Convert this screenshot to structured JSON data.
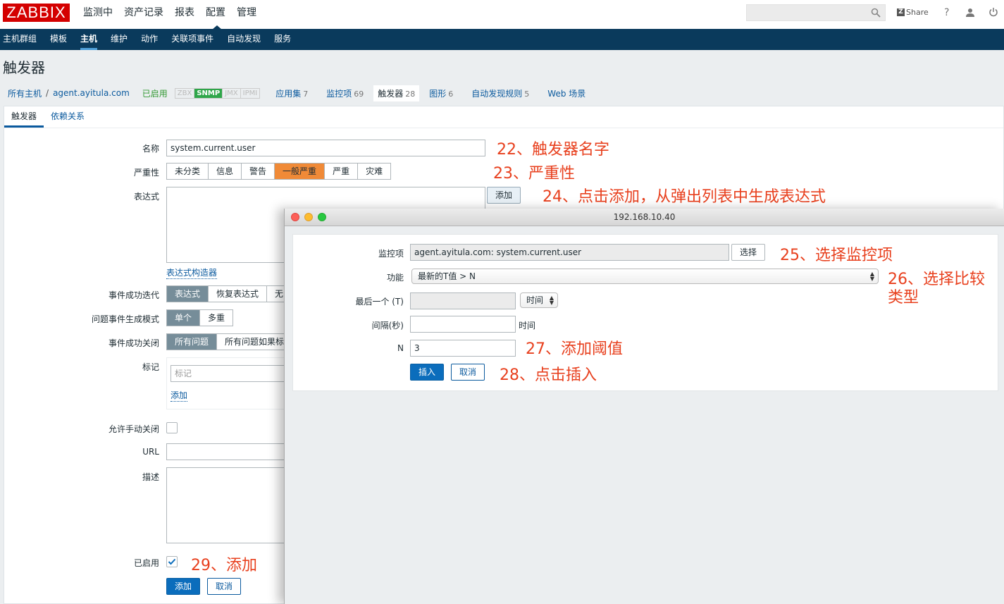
{
  "header": {
    "logo": "ZABBIX",
    "nav": [
      "监测中",
      "资产记录",
      "报表",
      "配置",
      "管理"
    ],
    "active_nav": "配置",
    "share": "Share",
    "help": "?"
  },
  "subnav": [
    "主机群组",
    "模板",
    "主机",
    "维护",
    "动作",
    "关联项事件",
    "自动发现",
    "服务"
  ],
  "page_title": "触发器",
  "breadcrumb": {
    "all_hosts": "所有主机",
    "sep": "/",
    "host": "agent.ayitula.com",
    "status": "已启用",
    "availability": [
      "ZBX",
      "SNMP",
      "JMX",
      "IPMI"
    ],
    "tabs": [
      {
        "label": "应用集",
        "count": "7"
      },
      {
        "label": "监控项",
        "count": "69"
      },
      {
        "label": "触发器",
        "count": "28"
      },
      {
        "label": "图形",
        "count": "6"
      },
      {
        "label": "自动发现规则",
        "count": "5"
      },
      {
        "label": "Web 场景",
        "count": ""
      }
    ]
  },
  "form_tabs": [
    "触发器",
    "依赖关系"
  ],
  "form": {
    "name_label": "名称",
    "name_value": "system.current.user",
    "severity_label": "严重性",
    "severity": [
      "未分类",
      "信息",
      "警告",
      "一般严重",
      "严重",
      "灾难"
    ],
    "severity_selected": "一般严重",
    "expression_label": "表达式",
    "expression_add": "添加",
    "expression_builder": "表达式构造器",
    "ok_event_gen_label": "事件成功迭代",
    "ok_event_gen": [
      "表达式",
      "恢复表达式",
      "无"
    ],
    "problem_mode_label": "问题事件生成模式",
    "problem_mode": [
      "单个",
      "多重"
    ],
    "ok_close_label": "事件成功关闭",
    "ok_close": [
      "所有问题",
      "所有问题如果标"
    ],
    "tags_label": "标记",
    "tag_placeholder": "标记",
    "tag_add": "添加",
    "manual_close_label": "允许手动关闭",
    "url_label": "URL",
    "desc_label": "描述",
    "enabled_label": "已启用",
    "add_button": "添加",
    "cancel_button": "取消"
  },
  "popup": {
    "title": "192.168.10.40",
    "item_label": "监控项",
    "item_value": "agent.ayitula.com: system.current.user",
    "select_button": "选择",
    "function_label": "功能",
    "function_value": "最新的T值 > N",
    "last_label": "最后一个 (T)",
    "last_unit": "时间",
    "interval_label": "间隔(秒)",
    "interval_suffix": "时间",
    "n_label": "N",
    "n_value": "3",
    "insert_button": "插入",
    "cancel_button": "取消"
  },
  "annotations": {
    "a22": "22、触发器名字",
    "a23": "23、严重性",
    "a24": "24、点击添加，从弹出列表中生成表达式",
    "a25": "25、选择监控项",
    "a26a": "26、选择比较",
    "a26b": "类型",
    "a27": "27、添加阈值",
    "a28": "28、点击插入",
    "a29": "29、添加"
  }
}
